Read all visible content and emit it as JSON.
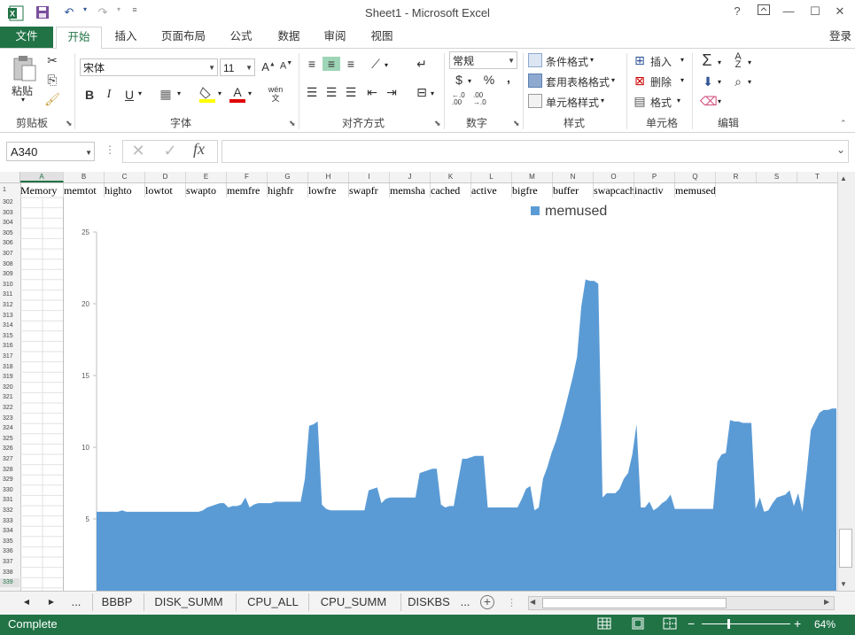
{
  "window": {
    "title": "Sheet1 - Microsoft Excel",
    "help": "?",
    "signin": "登录"
  },
  "ribbon": {
    "tabs": [
      "文件",
      "开始",
      "插入",
      "页面布局",
      "公式",
      "数据",
      "审阅",
      "视图"
    ],
    "clipboard": {
      "paste": "粘贴",
      "label": "剪贴板"
    },
    "font": {
      "name": "宋体",
      "size": "11",
      "label": "字体",
      "bold": "B",
      "italic": "I",
      "underline": "U",
      "phonetic": "wén"
    },
    "alignment": {
      "label": "对齐方式"
    },
    "number": {
      "format": "常规",
      "label": "数字",
      "currency": "$",
      "percent": "%",
      "comma": ","
    },
    "styles": {
      "conditional": "条件格式",
      "table": "套用表格格式",
      "cell": "单元格样式",
      "label": "样式"
    },
    "cells": {
      "insert": "插入",
      "delete": "删除",
      "format": "格式",
      "label": "单元格"
    },
    "editing": {
      "label": "编辑"
    }
  },
  "formula_bar": {
    "name_box": "A340",
    "fx": "fx",
    "formula": ""
  },
  "grid": {
    "columns": [
      "A",
      "B",
      "C",
      "D",
      "E",
      "F",
      "G",
      "H",
      "I",
      "J",
      "K",
      "L",
      "M",
      "N",
      "O",
      "P",
      "Q",
      "R",
      "S",
      "T"
    ],
    "row1_num": "1",
    "row1": [
      "Memory",
      "memtot",
      "highto",
      "lowtot",
      "swapto",
      "memfre",
      "highfr",
      "lowfre",
      "swapfr",
      "memsha",
      "cached",
      "active",
      "bigfre",
      "buffer",
      "swapcach",
      "inactiv",
      "memused"
    ],
    "rows": [
      "302",
      "303",
      "304",
      "305",
      "306",
      "307",
      "308",
      "309",
      "310",
      "311",
      "312",
      "313",
      "314",
      "315",
      "316",
      "317",
      "318",
      "319",
      "320",
      "321",
      "322",
      "323",
      "324",
      "325",
      "326",
      "327",
      "328",
      "329",
      "330",
      "331",
      "332",
      "333",
      "334",
      "335",
      "336",
      "337",
      "338",
      "339"
    ],
    "selected_row": "339"
  },
  "chart_data": {
    "type": "area",
    "series": [
      {
        "name": "memused",
        "color": "#5b9bd5",
        "values": [
          5.5,
          5.5,
          5.5,
          5.5,
          5.5,
          5.5,
          5.6,
          5.5,
          5.5,
          5.5,
          5.5,
          5.5,
          5.5,
          5.5,
          5.5,
          5.5,
          5.5,
          5.5,
          5.5,
          5.5,
          5.5,
          5.5,
          5.5,
          5.5,
          5.5,
          5.6,
          5.8,
          5.9,
          6.0,
          6.1,
          6.1,
          5.8,
          5.9,
          5.9,
          6.0,
          6.5,
          5.8,
          6.0,
          6.1,
          6.1,
          6.1,
          6.1,
          6.2,
          6.2,
          6.2,
          6.2,
          6.2,
          6.2,
          6.2,
          7.8,
          11.5,
          11.6,
          11.8,
          6.0,
          5.7,
          5.6,
          5.6,
          5.6,
          5.6,
          5.6,
          5.6,
          5.6,
          5.6,
          5.6,
          7.0,
          7.1,
          7.2,
          6.1,
          6.4,
          6.5,
          6.5,
          6.5,
          6.5,
          6.5,
          6.5,
          6.5,
          8.2,
          8.3,
          8.4,
          8.5,
          8.5,
          6.0,
          5.8,
          5.9,
          5.9,
          7.6,
          9.2,
          9.2,
          9.3,
          9.4,
          9.4,
          9.4,
          5.8,
          5.8,
          5.8,
          5.8,
          5.8,
          5.8,
          5.8,
          5.8,
          6.4,
          7.1,
          7.3,
          5.6,
          5.8,
          7.8,
          8.6,
          9.6,
          10.4,
          11.4,
          12.5,
          13.7,
          14.9,
          16.3,
          19.8,
          21.7,
          21.6,
          21.6,
          21.4,
          6.5,
          6.8,
          6.8,
          6.8,
          7.1,
          7.8,
          8.2,
          9.5,
          11.6,
          5.8,
          5.8,
          6.2,
          5.6,
          5.8,
          6.1,
          6.3,
          6.7,
          5.7,
          5.7,
          5.7,
          5.7,
          5.7,
          5.7,
          5.7,
          5.7,
          5.7,
          5.7,
          9.0,
          9.5,
          9.6,
          11.9,
          11.8,
          11.8,
          11.7,
          11.7,
          11.7,
          5.7,
          6.5,
          5.5,
          5.6,
          6.1,
          6.5,
          6.6,
          6.7,
          7.0,
          5.9,
          6.8,
          5.5,
          8.2,
          11.2,
          11.8,
          12.4,
          12.6,
          12.6,
          12.7,
          12.7
        ]
      }
    ],
    "y_ticks": [
      "5",
      "10",
      "15",
      "20",
      "25"
    ],
    "ylim": [
      0,
      25
    ],
    "legend": "top-right",
    "grid": false
  },
  "sheet_tabs": {
    "prev": "◀",
    "next": "▶",
    "more": "...",
    "tabs": [
      "BBBP",
      "DISK_SUMM",
      "CPU_ALL",
      "CPU_SUMM",
      "DISKBS"
    ],
    "more_right": "...",
    "add": "+"
  },
  "status": {
    "text": "Complete",
    "zoom": "64%",
    "zoom_level": 0.64
  }
}
